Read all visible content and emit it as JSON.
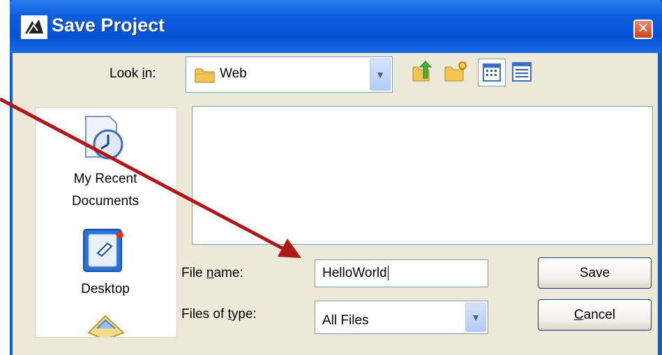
{
  "window": {
    "title": "Save Project",
    "close_glyph": "✕"
  },
  "toolbar": {
    "look_in_label_pre": "Look ",
    "look_in_label_key": "i",
    "look_in_label_post": "n:",
    "look_in_value": "Web",
    "icons": [
      "up-one-level-icon",
      "create-new-folder-icon",
      "list-view-icon",
      "details-view-icon"
    ]
  },
  "places": {
    "recent_line1": "My Recent",
    "recent_line2": "Documents",
    "desktop": "Desktop"
  },
  "form": {
    "file_name_label_pre": "File ",
    "file_name_label_key": "n",
    "file_name_label_post": "ame:",
    "file_name_value": "HelloWorld",
    "file_type_label_pre": "Files of ",
    "file_type_label_key": "t",
    "file_type_label_post": "ype:",
    "file_type_value": "All Files"
  },
  "buttons": {
    "save": "Save",
    "cancel_key": "C",
    "cancel_rest": "ancel"
  },
  "colors": {
    "titlebar": "#0653d4",
    "dialog_bg": "#ece9d8",
    "annotation_arrow": "#b01818"
  }
}
